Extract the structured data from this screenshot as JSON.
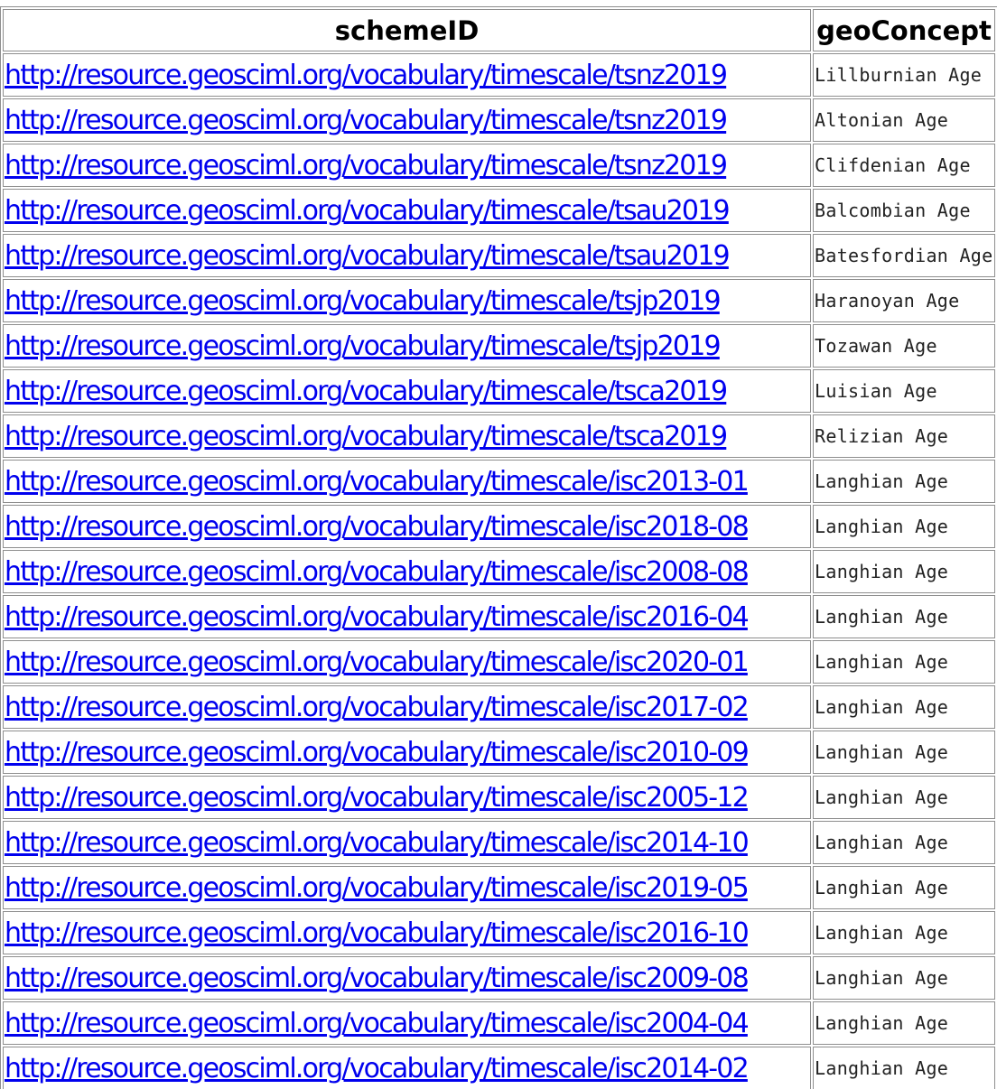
{
  "table": {
    "headers": {
      "scheme_id": "schemeID",
      "geo_concept": "geoConcept"
    },
    "rows": [
      {
        "scheme_id": "http://resource.geosciml.org/vocabulary/timescale/tsnz2019",
        "geo_concept": "Lillburnian Age"
      },
      {
        "scheme_id": "http://resource.geosciml.org/vocabulary/timescale/tsnz2019",
        "geo_concept": "Altonian Age"
      },
      {
        "scheme_id": "http://resource.geosciml.org/vocabulary/timescale/tsnz2019",
        "geo_concept": "Clifdenian Age"
      },
      {
        "scheme_id": "http://resource.geosciml.org/vocabulary/timescale/tsau2019",
        "geo_concept": "Balcombian Age"
      },
      {
        "scheme_id": "http://resource.geosciml.org/vocabulary/timescale/tsau2019",
        "geo_concept": "Batesfordian Age"
      },
      {
        "scheme_id": "http://resource.geosciml.org/vocabulary/timescale/tsjp2019",
        "geo_concept": "Haranoyan Age"
      },
      {
        "scheme_id": "http://resource.geosciml.org/vocabulary/timescale/tsjp2019",
        "geo_concept": "Tozawan Age"
      },
      {
        "scheme_id": "http://resource.geosciml.org/vocabulary/timescale/tsca2019",
        "geo_concept": "Luisian Age"
      },
      {
        "scheme_id": "http://resource.geosciml.org/vocabulary/timescale/tsca2019",
        "geo_concept": "Relizian Age"
      },
      {
        "scheme_id": "http://resource.geosciml.org/vocabulary/timescale/isc2013-01",
        "geo_concept": "Langhian Age"
      },
      {
        "scheme_id": "http://resource.geosciml.org/vocabulary/timescale/isc2018-08",
        "geo_concept": "Langhian Age"
      },
      {
        "scheme_id": "http://resource.geosciml.org/vocabulary/timescale/isc2008-08",
        "geo_concept": "Langhian Age"
      },
      {
        "scheme_id": "http://resource.geosciml.org/vocabulary/timescale/isc2016-04",
        "geo_concept": "Langhian Age"
      },
      {
        "scheme_id": "http://resource.geosciml.org/vocabulary/timescale/isc2020-01",
        "geo_concept": "Langhian Age"
      },
      {
        "scheme_id": "http://resource.geosciml.org/vocabulary/timescale/isc2017-02",
        "geo_concept": "Langhian Age"
      },
      {
        "scheme_id": "http://resource.geosciml.org/vocabulary/timescale/isc2010-09",
        "geo_concept": "Langhian Age"
      },
      {
        "scheme_id": "http://resource.geosciml.org/vocabulary/timescale/isc2005-12",
        "geo_concept": "Langhian Age"
      },
      {
        "scheme_id": "http://resource.geosciml.org/vocabulary/timescale/isc2014-10",
        "geo_concept": "Langhian Age"
      },
      {
        "scheme_id": "http://resource.geosciml.org/vocabulary/timescale/isc2019-05",
        "geo_concept": "Langhian Age"
      },
      {
        "scheme_id": "http://resource.geosciml.org/vocabulary/timescale/isc2016-10",
        "geo_concept": "Langhian Age"
      },
      {
        "scheme_id": "http://resource.geosciml.org/vocabulary/timescale/isc2009-08",
        "geo_concept": "Langhian Age"
      },
      {
        "scheme_id": "http://resource.geosciml.org/vocabulary/timescale/isc2004-04",
        "geo_concept": "Langhian Age"
      },
      {
        "scheme_id": "http://resource.geosciml.org/vocabulary/timescale/isc2014-02",
        "geo_concept": "Langhian Age"
      }
    ]
  },
  "colors": {
    "link": "#0000ee",
    "border": "#8e8e8e",
    "text": "#000000"
  }
}
